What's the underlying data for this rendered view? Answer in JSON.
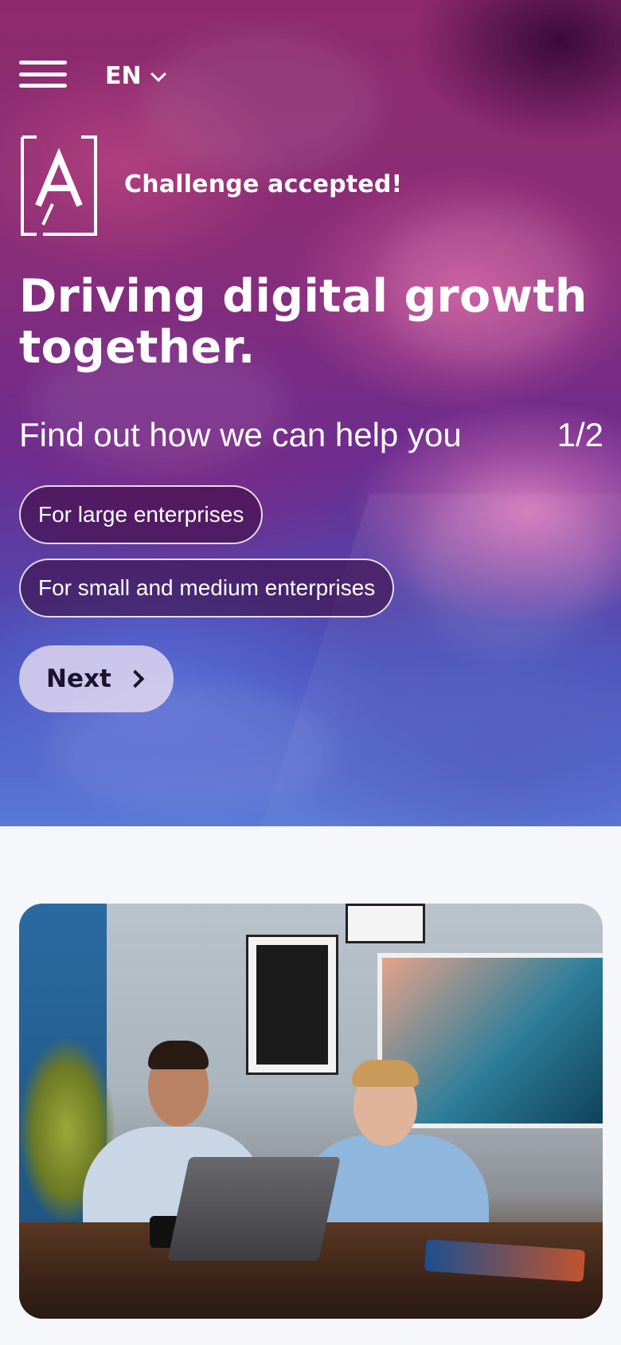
{
  "header": {
    "language": "EN",
    "tagline": "Challenge accepted!"
  },
  "hero": {
    "headline": "Driving digital growth together.",
    "help_text": "Find out how we can help you",
    "step_counter": "1/2",
    "options": [
      {
        "label": "For large enterprises"
      },
      {
        "label": "For small and medium enterprises"
      }
    ],
    "next_label": "Next"
  },
  "colors": {
    "hero_top": "#8e2a6c",
    "hero_bottom": "#5a7ad8",
    "page_background": "#f6f7fb",
    "button_text": "#1b1430"
  },
  "icons": {
    "menu": "hamburger-icon",
    "language_toggle": "chevron-down-icon",
    "next": "chevron-right-icon",
    "logo": "brand-logo-icon"
  }
}
